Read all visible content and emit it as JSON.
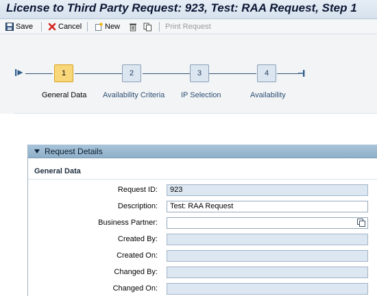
{
  "window": {
    "title": "License to Third Party Request: 923, Test: RAA Request, Step 1"
  },
  "toolbar": {
    "save_label": "Save",
    "cancel_label": "Cancel",
    "new_label": "New",
    "print_label": "Print Request",
    "icons": [
      "save-icon",
      "cancel-icon",
      "new-icon",
      "delete-icon",
      "copy-icon"
    ]
  },
  "roadmap": {
    "steps": [
      {
        "number": "1",
        "label": "General Data",
        "active": true
      },
      {
        "number": "2",
        "label": "Availability Criteria",
        "active": false
      },
      {
        "number": "3",
        "label": "IP Selection",
        "active": false
      },
      {
        "number": "4",
        "label": "Availability",
        "active": false
      }
    ]
  },
  "panel": {
    "title": "Request Details",
    "group_title": "General Data",
    "fields": [
      {
        "label": "Request ID:",
        "value": "923",
        "editable": false
      },
      {
        "label": "Description:",
        "value": "Test: RAA Request",
        "editable": true
      },
      {
        "label": "Business Partner:",
        "value": "",
        "editable": true,
        "value_help": true
      },
      {
        "label": "Created By:",
        "value": "",
        "editable": false
      },
      {
        "label": "Created On:",
        "value": "",
        "editable": false
      },
      {
        "label": "Changed By:",
        "value": "",
        "editable": false
      },
      {
        "label": "Changed On:",
        "value": "",
        "editable": false
      }
    ]
  },
  "colors": {
    "active_step": "#f8d67a",
    "inactive_step": "#dce6f0",
    "panel_header": "#a9c4d9",
    "readonly_field": "#dde7f1",
    "cancel_red": "#d3231b"
  }
}
